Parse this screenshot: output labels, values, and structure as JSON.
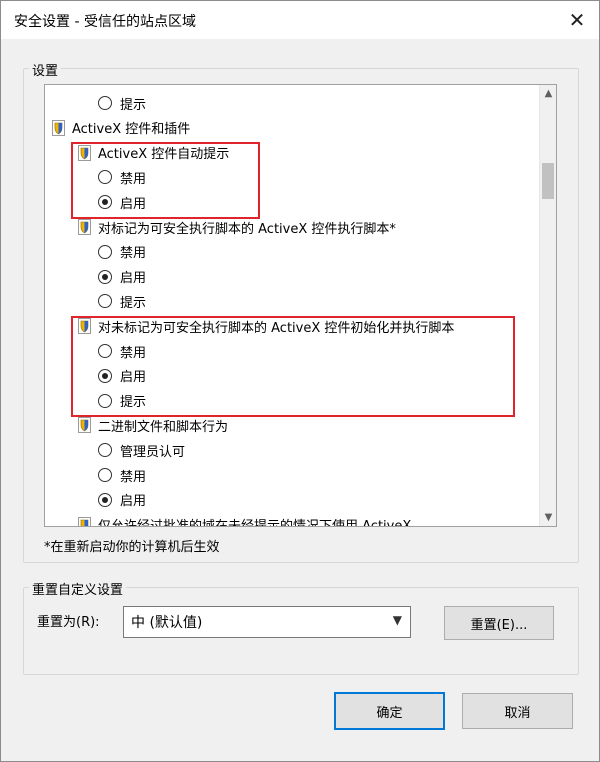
{
  "window": {
    "title": "安全设置 - 受信任的站点区域",
    "close_glyph": "✕"
  },
  "settings_group": {
    "label": "设置"
  },
  "tree": {
    "rows": [
      {
        "type": "radio",
        "label": "提示",
        "checked": false
      },
      {
        "type": "heading",
        "label": "ActiveX 控件和插件",
        "icon": "shield-icon"
      },
      {
        "type": "heading",
        "label": "ActiveX 控件自动提示",
        "icon": "shield-icon"
      },
      {
        "type": "radio",
        "label": "禁用",
        "checked": false
      },
      {
        "type": "radio",
        "label": "启用",
        "checked": true
      },
      {
        "type": "heading",
        "label": "对标记为可安全执行脚本的 ActiveX 控件执行脚本*",
        "icon": "shield-icon"
      },
      {
        "type": "radio",
        "label": "禁用",
        "checked": false
      },
      {
        "type": "radio",
        "label": "启用",
        "checked": true
      },
      {
        "type": "radio",
        "label": "提示",
        "checked": false
      },
      {
        "type": "heading",
        "label": "对未标记为可安全执行脚本的 ActiveX 控件初始化并执行脚本",
        "icon": "shield-icon"
      },
      {
        "type": "radio",
        "label": "禁用",
        "checked": false
      },
      {
        "type": "radio",
        "label": "启用",
        "checked": true
      },
      {
        "type": "radio",
        "label": "提示",
        "checked": false
      },
      {
        "type": "heading",
        "label": "二进制文件和脚本行为",
        "icon": "shield-icon"
      },
      {
        "type": "radio",
        "label": "管理员认可",
        "checked": false
      },
      {
        "type": "radio",
        "label": "禁用",
        "checked": false
      },
      {
        "type": "radio",
        "label": "启用",
        "checked": true
      },
      {
        "type": "heading",
        "label": "仅允许经过批准的域在未经提示的情况下使用 ActiveX",
        "icon": "shield-icon"
      }
    ]
  },
  "note": "*在重新启动你的计算机后生效",
  "reset_group": {
    "label": "重置自定义设置",
    "reset_to_label": "重置为(R):",
    "selected_level": "中 (默认值)",
    "reset_button": "重置(E)..."
  },
  "footer": {
    "ok": "确定",
    "cancel": "取消"
  },
  "colors": {
    "highlight": "#e0242c",
    "default_button_border": "#0078d7"
  }
}
